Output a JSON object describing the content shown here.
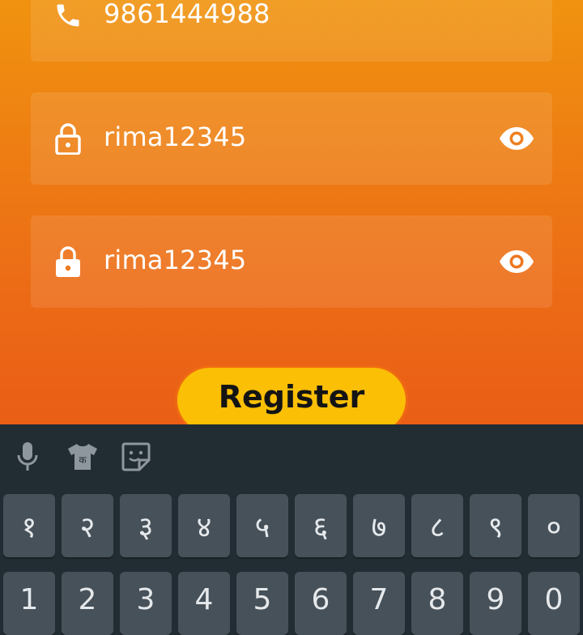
{
  "form": {
    "phone_value": "9861444988",
    "password_value": "rima12345",
    "confirm_password_value": "rima12345",
    "register_label": "Register"
  },
  "keyboard": {
    "toolbar": [
      "mic-icon",
      "tshirt-icon",
      "sticker-icon"
    ],
    "tshirt_glyph": "क",
    "row1": [
      "१",
      "२",
      "३",
      "४",
      "५",
      "६",
      "७",
      "८",
      "९",
      "०"
    ],
    "row2": [
      "1",
      "2",
      "3",
      "4",
      "5",
      "6",
      "7",
      "8",
      "9",
      "0"
    ]
  },
  "colors": {
    "accent": "#fbbf06",
    "background_top": "#f0930f",
    "background_bottom": "#ea5e16",
    "keyboard_bg": "#222c33",
    "key_bg": "#46515a"
  }
}
